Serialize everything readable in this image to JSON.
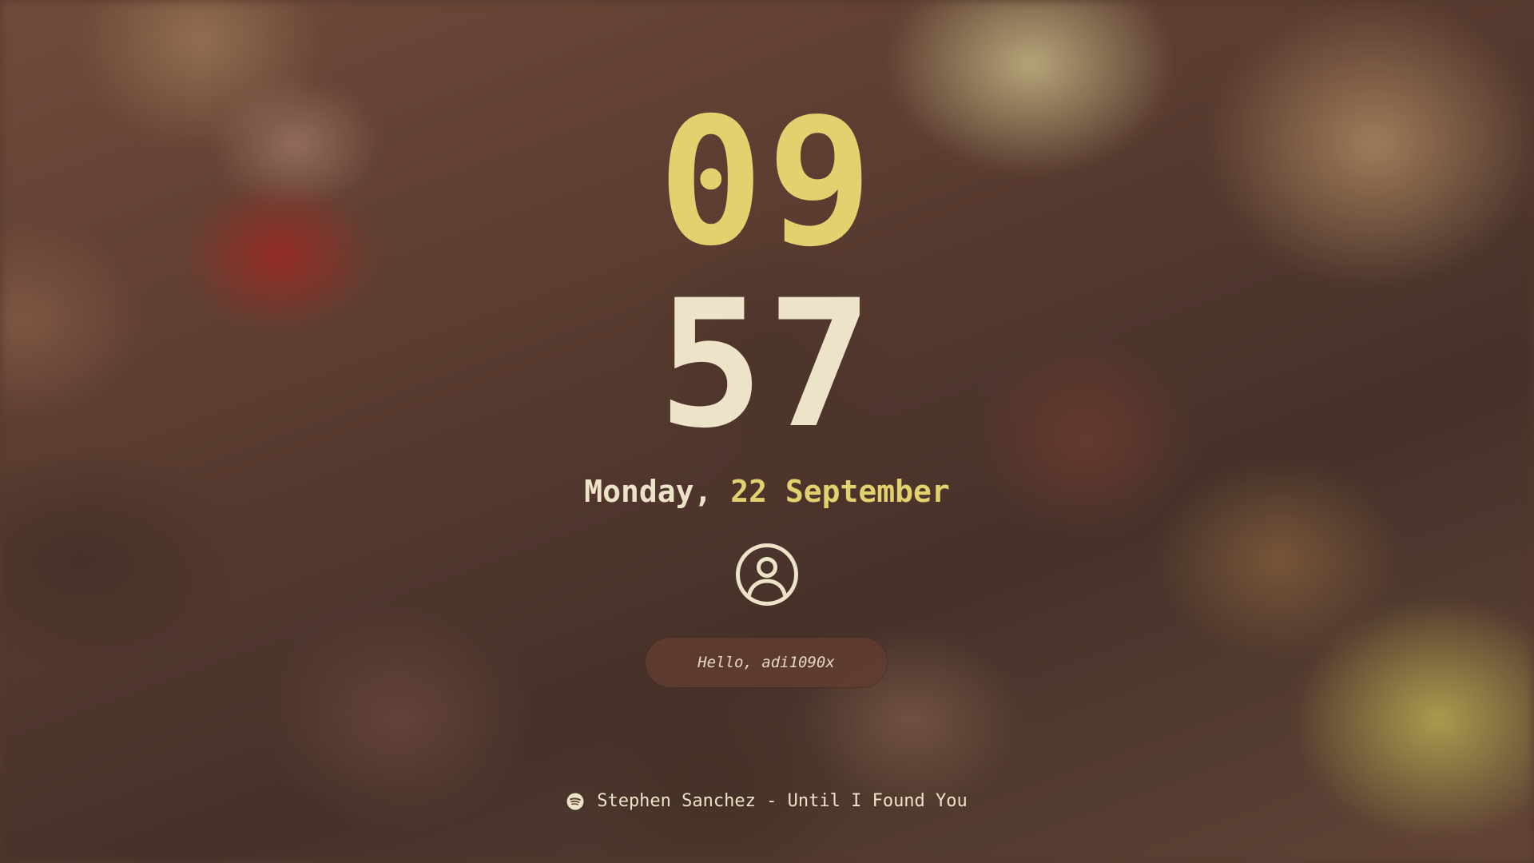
{
  "lock_screen": {
    "clock": {
      "hour": "09",
      "minute": "57"
    },
    "date": {
      "weekday": "Monday,",
      "day_month": "22 September"
    },
    "avatar_icon": "user-circle-icon",
    "greeting": "Hello, adi1090x",
    "media": {
      "icon": "spotify-icon",
      "track": "Stephen Sanchez - Until I Found You"
    }
  },
  "colors": {
    "accent_yellow": "#e3d16f",
    "text_cream": "#ede3c8",
    "pill_background": "#5f3c30"
  }
}
